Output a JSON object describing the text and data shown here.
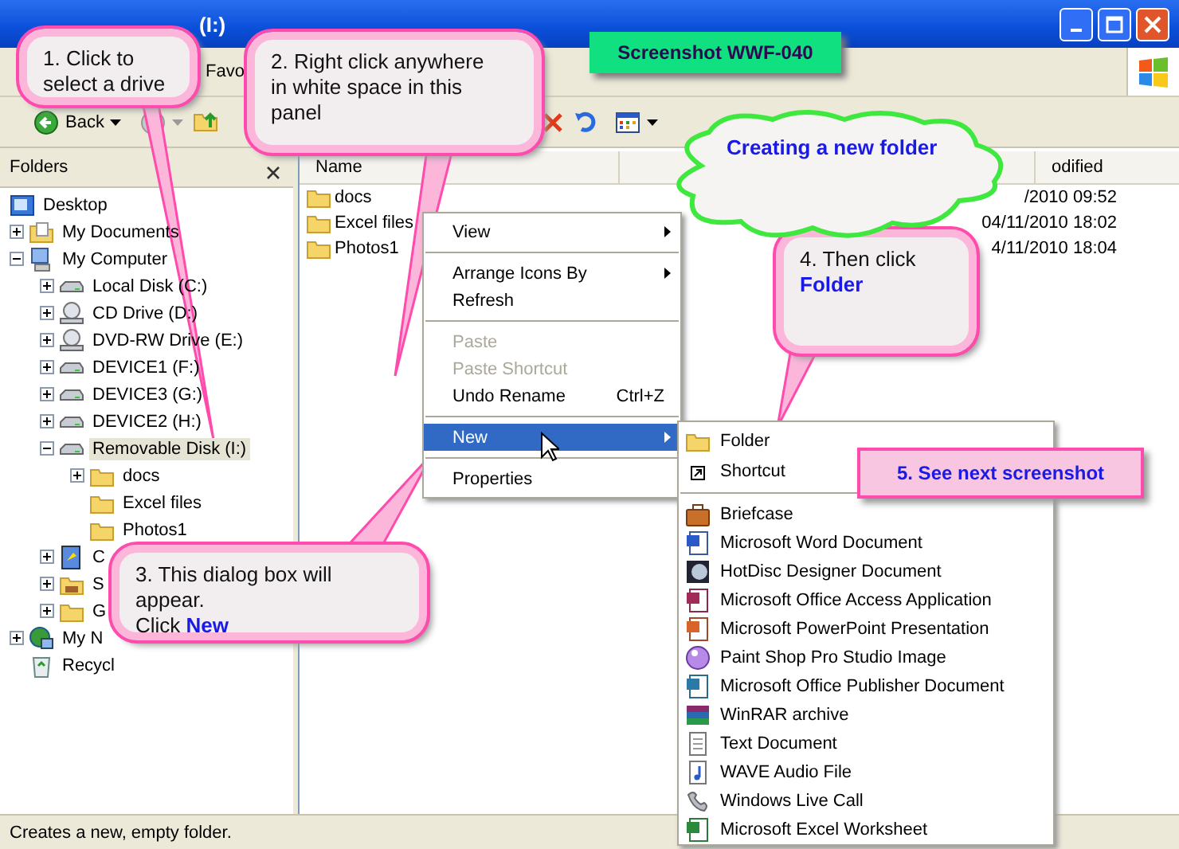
{
  "window": {
    "title": "(I:)"
  },
  "menu_bar": [
    "Favo"
  ],
  "toolbar": {
    "back": "Back"
  },
  "folders_panel": {
    "title": "Folders",
    "tree": [
      {
        "label": "Desktop",
        "kind": "desktop",
        "selected": false,
        "children": [
          {
            "label": "My Documents",
            "kind": "documents",
            "expanded": false,
            "selected": false
          },
          {
            "label": "My Computer",
            "kind": "computer",
            "expanded": true,
            "selected": false,
            "children": [
              {
                "label": "Local Disk (C:)",
                "kind": "drive",
                "expanded": false,
                "selected": false
              },
              {
                "label": "CD Drive (D:)",
                "kind": "cd",
                "expanded": false,
                "selected": false
              },
              {
                "label": "DVD-RW Drive (E:)",
                "kind": "cd",
                "expanded": false,
                "selected": false
              },
              {
                "label": "DEVICE1 (F:)",
                "kind": "drive",
                "expanded": false,
                "selected": false
              },
              {
                "label": "DEVICE3 (G:)",
                "kind": "drive",
                "expanded": false,
                "selected": false
              },
              {
                "label": "DEVICE2 (H:)",
                "kind": "drive",
                "expanded": false,
                "selected": false
              },
              {
                "label": "Removable Disk (I:)",
                "kind": "drive",
                "expanded": true,
                "selected": true,
                "children": [
                  {
                    "label": "docs",
                    "kind": "folder",
                    "expanded": false,
                    "selected": false
                  },
                  {
                    "label": "Excel files",
                    "kind": "folder",
                    "selected": false
                  },
                  {
                    "label": "Photos1",
                    "kind": "folder",
                    "selected": false
                  }
                ]
              },
              {
                "label": "C",
                "kind": "control",
                "expanded": false,
                "selected": false
              },
              {
                "label": "S",
                "kind": "shared",
                "expanded": false,
                "selected": false
              },
              {
                "label": "G",
                "kind": "folder",
                "expanded": false,
                "selected": false
              }
            ]
          },
          {
            "label": "My N",
            "kind": "network",
            "expanded": false,
            "selected": false
          },
          {
            "label": "Recycl",
            "kind": "recycle",
            "selected": false
          }
        ]
      }
    ]
  },
  "file_list": {
    "columns": [
      "Name",
      "odified"
    ],
    "rows": [
      {
        "name": "docs",
        "modified": "/2010 09:52"
      },
      {
        "name": "Excel files",
        "modified": "04/11/2010 18:02"
      },
      {
        "name": "Photos1",
        "modified": "4/11/2010 18:04"
      }
    ]
  },
  "status_bar": "Creates a new, empty folder.",
  "context_menu": [
    {
      "kind": "item",
      "label": "View",
      "submenu": true,
      "disabled": false,
      "selected": false
    },
    {
      "kind": "separator"
    },
    {
      "kind": "item",
      "label": "Arrange Icons By",
      "submenu": true,
      "disabled": false,
      "selected": false
    },
    {
      "kind": "item",
      "label": "Refresh",
      "submenu": false,
      "disabled": false,
      "selected": false
    },
    {
      "kind": "separator"
    },
    {
      "kind": "item",
      "label": "Paste",
      "submenu": false,
      "disabled": true,
      "selected": false
    },
    {
      "kind": "item",
      "label": "Paste Shortcut",
      "submenu": false,
      "disabled": true,
      "selected": false
    },
    {
      "kind": "item",
      "label": "Undo Rename",
      "shortcut": "Ctrl+Z",
      "submenu": false,
      "disabled": false,
      "selected": false
    },
    {
      "kind": "separator"
    },
    {
      "kind": "item",
      "label": "New",
      "submenu": true,
      "disabled": false,
      "selected": true
    },
    {
      "kind": "separator"
    },
    {
      "kind": "item",
      "label": "Properties",
      "submenu": false,
      "disabled": false,
      "selected": false
    }
  ],
  "new_submenu": [
    {
      "kind": "folder",
      "label": "Folder"
    },
    {
      "kind": "shortcut",
      "label": "Shortcut"
    },
    {
      "kind": "separator"
    },
    {
      "kind": "briefcase",
      "label": "Briefcase"
    },
    {
      "kind": "word",
      "label": "Microsoft Word Document"
    },
    {
      "kind": "disc",
      "label": "HotDisc Designer Document"
    },
    {
      "kind": "access",
      "label": "Microsoft Office Access Application"
    },
    {
      "kind": "powerpoint",
      "label": "Microsoft PowerPoint Presentation"
    },
    {
      "kind": "orb",
      "label": "Paint Shop Pro Studio Image"
    },
    {
      "kind": "publisher",
      "label": "Microsoft Office Publisher Document"
    },
    {
      "kind": "archive",
      "label": "WinRAR archive"
    },
    {
      "kind": "text",
      "label": "Text Document"
    },
    {
      "kind": "audio",
      "label": "WAVE Audio File"
    },
    {
      "kind": "phone",
      "label": "Windows Live Call"
    },
    {
      "kind": "excel",
      "label": "Microsoft Excel Worksheet"
    }
  ],
  "callouts": [
    {
      "kind": "bubble",
      "text": "1. Click to\nselect a drive"
    },
    {
      "kind": "bubble",
      "text": "2. Right click anywhere\nin white space in this\npanel"
    },
    {
      "kind": "bubble",
      "text": "3. This dialog box will\nappear.\nClick **New**"
    },
    {
      "kind": "bubble",
      "text": "4. Then click\n**Folder**"
    },
    {
      "kind": "box",
      "text": "5. See next screenshot"
    }
  ],
  "banner": "Screenshot WWF-040",
  "cloud": "Creating a new folder"
}
